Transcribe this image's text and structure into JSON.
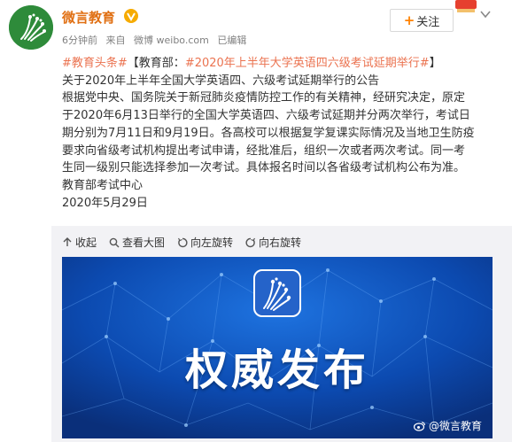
{
  "account": {
    "name": "微言教育",
    "verified": true,
    "avatar_icon": "education-logo-icon",
    "brand_color": "#e06f12",
    "avatar_color": "#2e8b3a"
  },
  "meta": {
    "time": "6分钟前",
    "source_prefix": "来自",
    "source": "微博 weibo.com",
    "status": "已编辑"
  },
  "follow_button": {
    "label": "关注"
  },
  "post": {
    "topic": "#教育头条#",
    "headline_prefix": "【教育部：",
    "headline_topic": "#2020年上半年大学英语四六级考试延期举行#",
    "headline_suffix": "】",
    "lines": [
      "关于2020年上半年全国大学英语四、六级考试延期举行的公告",
      "根据党中央、国务院关于新冠肺炎疫情防控工作的有关精神，经研究决定，原定",
      "于2020年6月13日举行的全国大学英语四、六级考试延期并分两次举行，考试日",
      "期分别为7月11日和9月19日。各高校可以根据复学复课实际情况及当地卫生防疫",
      "要求向省级考试机构提出考试申请，经批准后，组织一次或者两次考试。同一考",
      "生同一级别只能选择参加一次考试。具体报名时间以各省级考试机构公布为准。",
      "教育部考试中心",
      "2020年5月29日"
    ],
    "highlight_color": "#eb7350"
  },
  "toolbar": {
    "collapse": "收起",
    "view_large": "查看大图",
    "rotate_left": "向左旋转",
    "rotate_right": "向右旋转"
  },
  "banner": {
    "title": "权威发布",
    "watermark": "@微言教育",
    "background": "#0c4ab0"
  }
}
